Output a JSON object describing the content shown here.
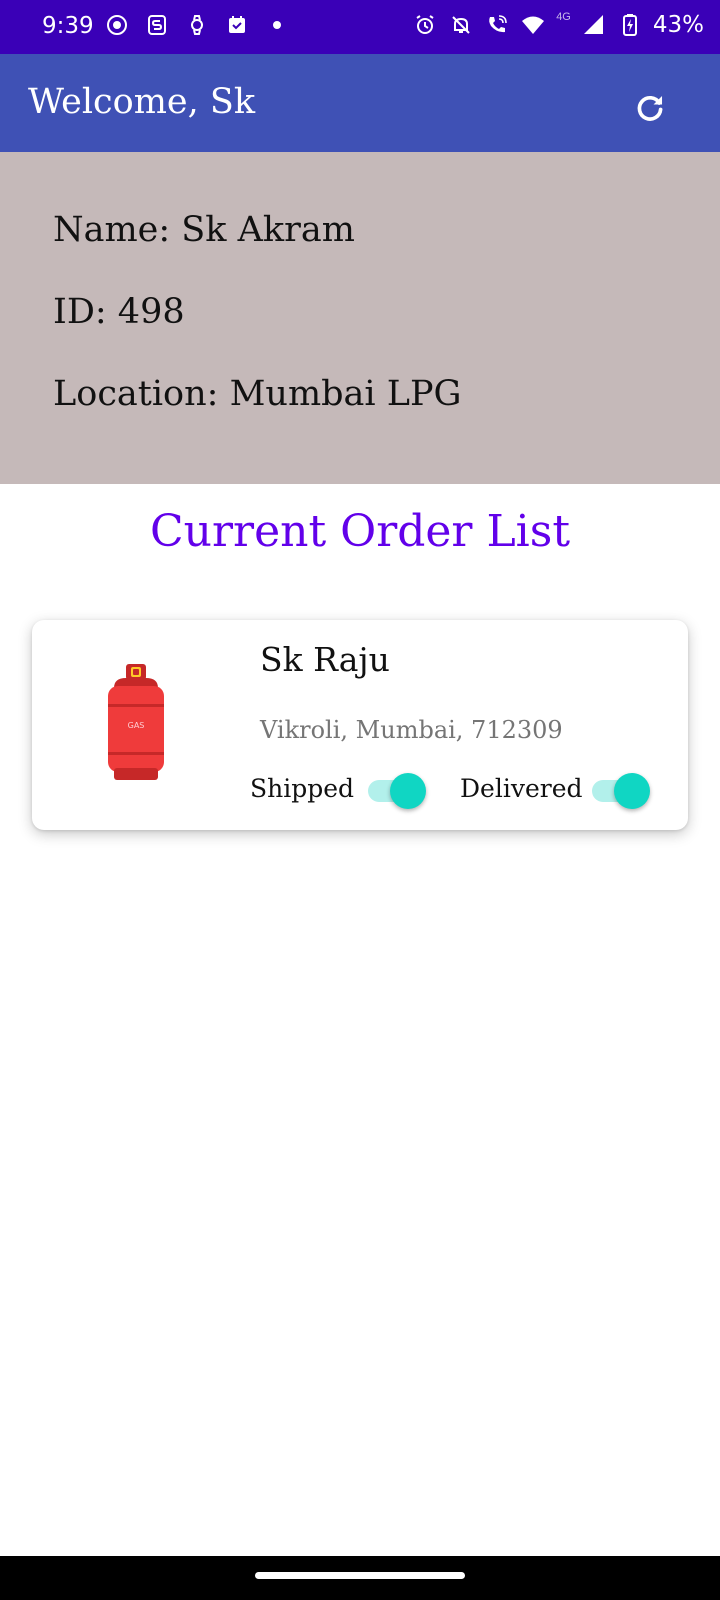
{
  "status_bar": {
    "time": "9:39",
    "network_type": "4G",
    "battery_percent": "43%",
    "left_icons": [
      "screen-record-icon",
      "s-app-icon",
      "watch-icon",
      "calendar-icon",
      "dot-icon"
    ],
    "right_icons": [
      "alarm-icon",
      "bell-off-icon",
      "wifi-call-icon",
      "wifi-icon",
      "signal-icon",
      "battery-charging-icon"
    ]
  },
  "app_bar": {
    "title": "Welcome, Sk",
    "refresh_icon": "refresh-icon",
    "background": "#3f51b5"
  },
  "profile": {
    "name": "Name: Sk Akram",
    "id": "ID: 498",
    "location": "Location: Mumbai LPG",
    "background": "#c5b9b9"
  },
  "orders": {
    "title": "Current Order List",
    "title_color": "#6200ea",
    "items": [
      {
        "icon": "gas-cylinder-icon",
        "customer": "Sk Raju",
        "address": "Vikroli, Mumbai, 712309",
        "shipped_label": "Shipped",
        "shipped": true,
        "delivered_label": "Delivered",
        "delivered": true
      }
    ]
  },
  "colors": {
    "status_bar": "#3a00b7",
    "switch_on": "#10d6c3"
  }
}
